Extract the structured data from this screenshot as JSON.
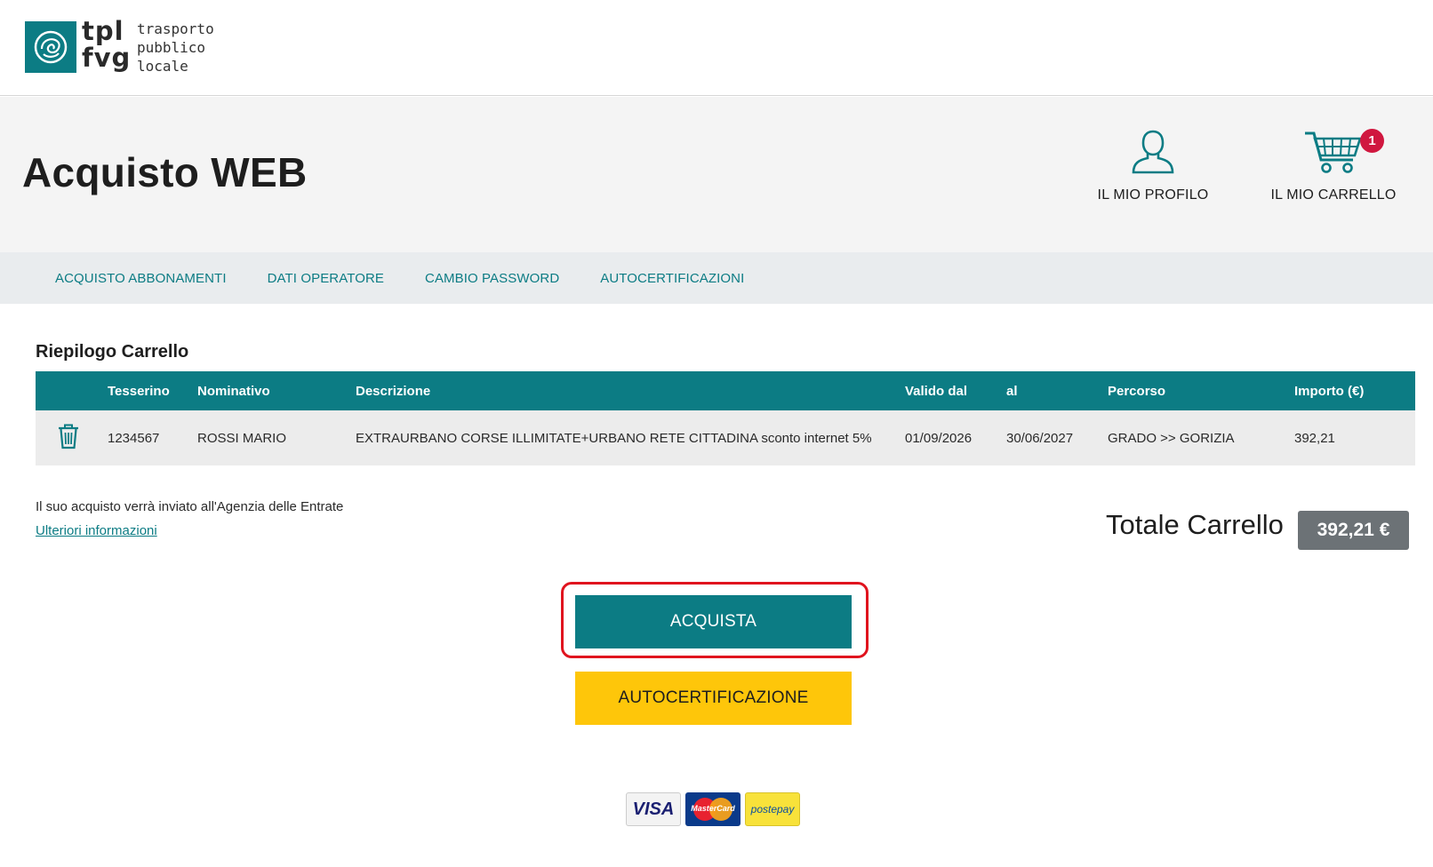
{
  "logo": {
    "abbr_line1": "tpl",
    "abbr_line2": "fvg",
    "sub_line1": "trasporto",
    "sub_line2": "pubblico",
    "sub_line3": "locale",
    "brand_color": "#0c7c84"
  },
  "header": {
    "title": "Acquisto WEB",
    "profile_label": "IL MIO PROFILO",
    "cart_label": "IL MIO CARRELLO",
    "cart_badge": "1",
    "profile_icon": "user-icon",
    "cart_icon": "shopping-cart-icon"
  },
  "nav": {
    "items": [
      "ACQUISTO ABBONAMENTI",
      "DATI OPERATORE",
      "CAMBIO PASSWORD",
      "AUTOCERTIFICAZIONI"
    ]
  },
  "cart_summary": {
    "title": "Riepilogo Carrello",
    "columns": [
      "Tesserino",
      "Nominativo",
      "Descrizione",
      "Valido dal",
      "al",
      "Percorso",
      "Importo (€)"
    ],
    "rows": [
      {
        "tesserino": "1234567",
        "nominativo": "ROSSI MARIO",
        "descrizione": "EXTRAURBANO CORSE ILLIMITATE+URBANO RETE CITTADINA sconto internet 5%",
        "valido_dal": "01/09/2026",
        "al": "30/06/2027",
        "percorso": "GRADO >> GORIZIA",
        "importo": "392,21",
        "action_icon": "trash-icon"
      }
    ]
  },
  "footer_info": {
    "note": "Il suo acquisto verrà inviato all'Agenzia delle Entrate",
    "link": "Ulteriori informazioni"
  },
  "total": {
    "label": "Totale Carrello",
    "value": "392,21 €"
  },
  "buttons": {
    "acquista": "ACQUISTA",
    "autocertificazione": "AUTOCERTIFICAZIONE"
  },
  "payments": {
    "visa": "VISA",
    "mastercard": "MasterCard",
    "postepay": "postepay"
  },
  "colors": {
    "teal": "#0c7c84",
    "yellow": "#fec60a",
    "badge_red": "#d0173f",
    "highlight_red": "#e0141e",
    "total_bg": "#6c7276"
  }
}
